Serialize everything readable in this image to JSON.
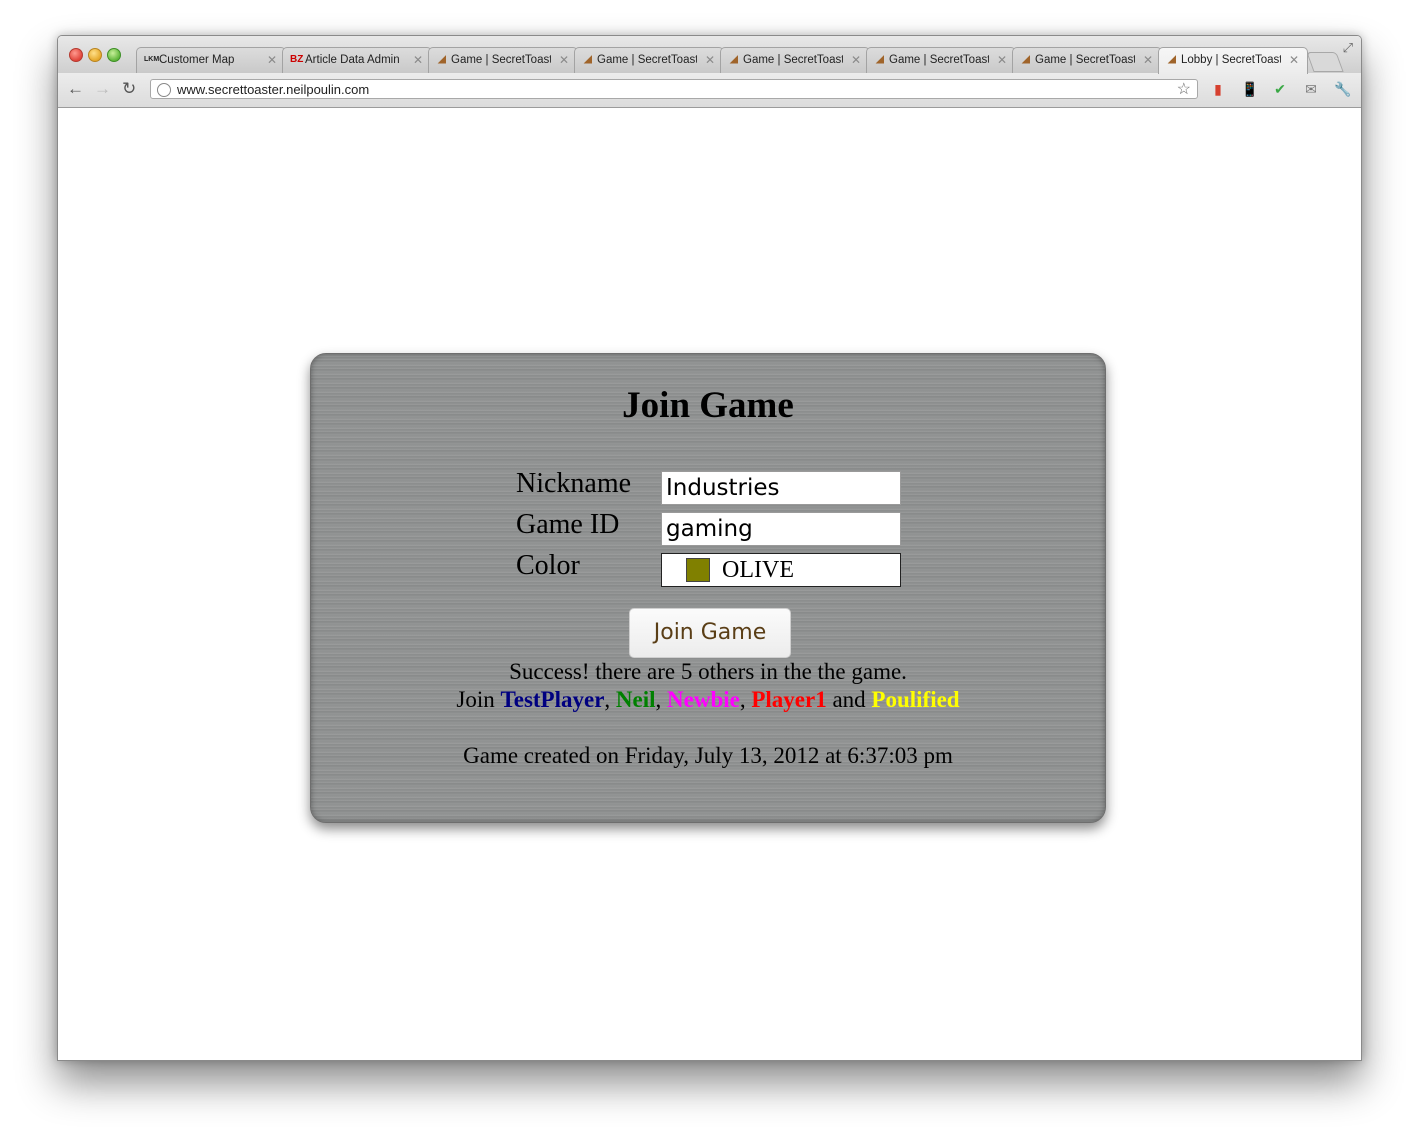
{
  "browser": {
    "tabs": [
      {
        "label": "Customer Map",
        "favicon": "LKM"
      },
      {
        "label": "Article Data Admin",
        "favicon": "BZ"
      },
      {
        "label": "Game | SecretToaster",
        "favicon": "toast"
      },
      {
        "label": "Game | SecretToaster",
        "favicon": "toast"
      },
      {
        "label": "Game | SecretToaster",
        "favicon": "toast"
      },
      {
        "label": "Game | SecretToaster",
        "favicon": "toast"
      },
      {
        "label": "Game | SecretToaster",
        "favicon": "toast"
      },
      {
        "label": "Lobby | SecretToaster",
        "favicon": "toast",
        "active": true
      }
    ],
    "url": "www.secrettoaster.neilpoulin.com"
  },
  "form": {
    "title": "Join Game",
    "nickname_label": "Nickname",
    "nickname_value": "Industries",
    "gameid_label": "Game ID",
    "gameid_value": "gaming",
    "color_label": "Color",
    "color_value": "OLIVE",
    "color_swatch": "#808000",
    "join_button": "Join Game"
  },
  "status": {
    "success": "Success! there are 5 others in the the game.",
    "join_prefix": "Join",
    "players": [
      {
        "name": "TestPlayer",
        "color": "#000080"
      },
      {
        "name": "Neil",
        "color": "#008000"
      },
      {
        "name": "Newbie",
        "color": "#ff00ff"
      },
      {
        "name": "Player1",
        "color": "#ff0000"
      },
      {
        "name": "Poulified",
        "color": "#ffff00"
      }
    ],
    "sep_comma": ",",
    "sep_and": "and",
    "created": "Game created on Friday, July 13, 2012 at 6:37:03 pm"
  }
}
